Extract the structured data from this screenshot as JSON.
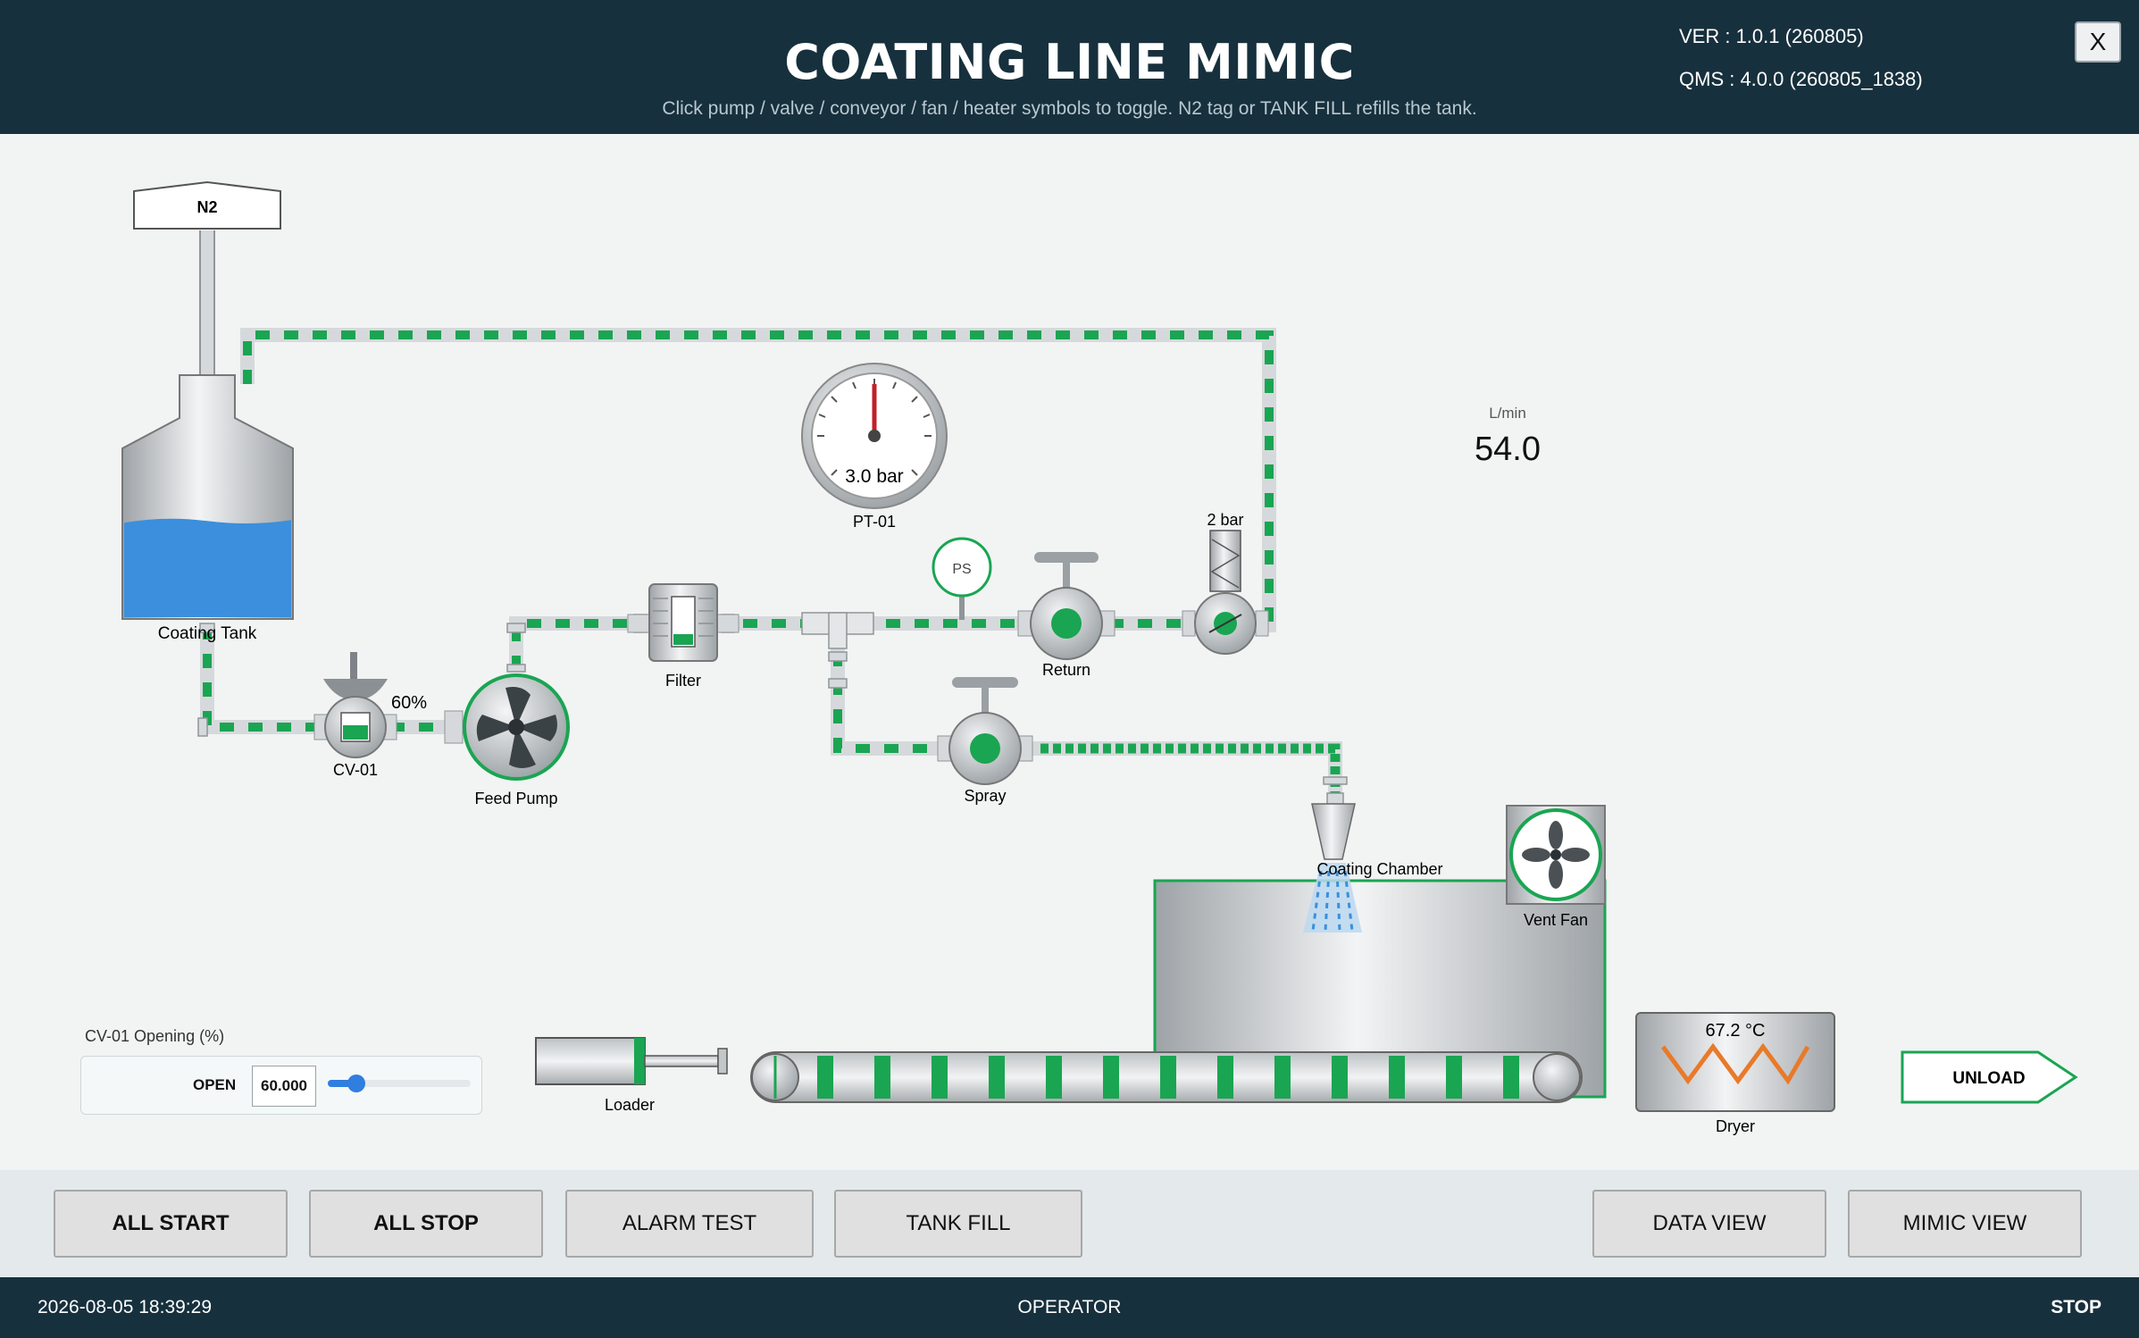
{
  "header": {
    "title": "COATING LINE MIMIC",
    "subtitle": "Click pump / valve / conveyor / fan / heater symbols to toggle.  N2 tag or TANK FILL refills the tank.",
    "version": "VER : 1.0.1 (260805)",
    "qms": "QMS : 4.0.0 (260805_1838)",
    "close_label": "X"
  },
  "mimic": {
    "n2_tag": "N2",
    "tank_label": "Coating Tank",
    "cv01_label": "CV-01",
    "cv01_opening_text": "60%",
    "feed_pump_label": "Feed Pump",
    "filter_label": "Filter",
    "pressure_gauge": {
      "label": "PT-01",
      "value_text": "3.0 bar"
    },
    "pressure_switch_label": "PS",
    "return_valve_label": "Return",
    "relief_valve_label": "2 bar",
    "spray_valve_label": "Spray",
    "flow": {
      "unit": "L/min",
      "value": "54.0"
    },
    "chamber_label": "Coating Chamber",
    "vent_fan_label": "Vent Fan",
    "loader_label": "Loader",
    "dryer": {
      "label": "Dryer",
      "temp_text": "67.2 °C"
    },
    "unload_label": "UNLOAD",
    "tank_level_fraction": 0.57,
    "pump_running": true,
    "colors": {
      "flow": "#1aa552",
      "pipe": "#d6d9dc",
      "liquid": "#3b8fdc",
      "heater": "#e87a2a",
      "frame": "#17303d"
    }
  },
  "cv01_panel": {
    "title": "CV-01 Opening (%)",
    "label": "OPEN",
    "value": "60.000",
    "fraction": 0.2
  },
  "toolbar": {
    "all_start": "ALL START",
    "all_stop": "ALL STOP",
    "alarm_test": "ALARM TEST",
    "tank_fill": "TANK FILL",
    "data_view": "DATA VIEW",
    "mimic_view": "MIMIC VIEW"
  },
  "footer": {
    "datetime": "2026-08-05 18:39:29",
    "role": "OPERATOR",
    "state": "STOP"
  }
}
